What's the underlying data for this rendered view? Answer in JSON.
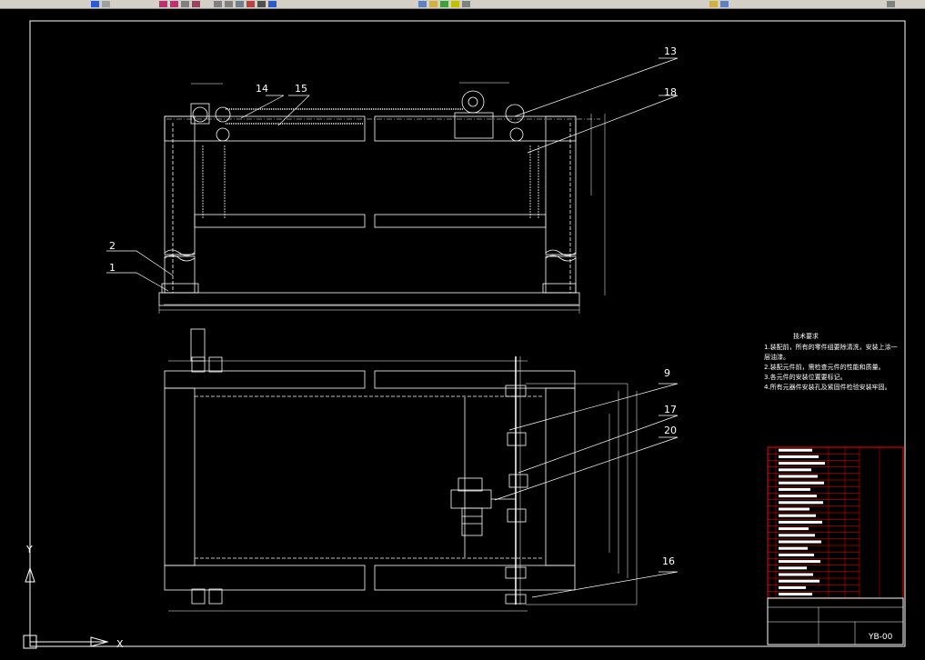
{
  "toolbar": {
    "icons": [
      "save-icon",
      "arrow-left-icon",
      "arrow-right-icon",
      "pan-icon",
      "zoom-icon",
      "zoom-window-icon",
      "zoom-previous-icon",
      "text-icon",
      "properties-icon",
      "design-center-icon",
      "tool-palette-icon",
      "sheet-set-icon",
      "calculator-icon",
      "help-icon",
      "layer-icon",
      "layer-state-icon",
      "layer-previous-icon",
      "color-icon",
      "linetype-icon",
      "lineweight-icon",
      "plot-style-icon"
    ]
  },
  "leaders": [
    {
      "id": "1",
      "label": "1"
    },
    {
      "id": "2",
      "label": "2"
    },
    {
      "id": "9",
      "label": "9"
    },
    {
      "id": "13",
      "label": "13"
    },
    {
      "id": "14",
      "label": "14"
    },
    {
      "id": "15",
      "label": "15"
    },
    {
      "id": "16",
      "label": "16"
    },
    {
      "id": "17",
      "label": "17"
    },
    {
      "id": "18",
      "label": "18"
    },
    {
      "id": "20",
      "label": "20"
    }
  ],
  "notes": {
    "title": "技术要求",
    "lines": [
      "1.装配前，所有的零件组要除清洗，安装上涂一",
      "层油漆。",
      "2.装配元件前，需检查元件的性能和质量。",
      "3.各元件的安装位置要标记。",
      "4.所有元器件安装孔及紧固件检验安装牢固。"
    ]
  },
  "title_block": {
    "drawing_no": "YB-00",
    "colors": {
      "border": "#ff0000",
      "text": "#ffffff",
      "lines": "#ffffff"
    }
  },
  "colors": {
    "background": "#000000",
    "outline": "#ffffff",
    "leader": "#ffffff",
    "table_border": "#ff0000"
  },
  "ucs": {
    "y_label": "Y",
    "x_label": "X"
  }
}
